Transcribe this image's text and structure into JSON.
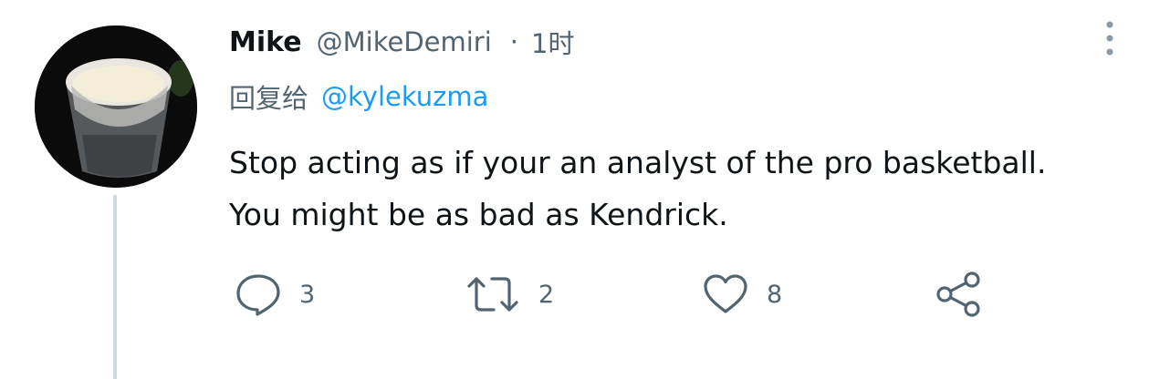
{
  "tweet": {
    "author_name": "Mike",
    "author_handle": "@MikeDemiri",
    "separator": "·",
    "timestamp": "1时",
    "reply_prefix": "回复给",
    "reply_mention": "@kylekuzma",
    "text_lines": [
      "Stop acting as if your an analyst of the pro basketball.",
      "You might be as bad as Kendrick."
    ]
  },
  "actions": {
    "reply": {
      "icon": "reply-icon",
      "count": "3"
    },
    "retweet": {
      "icon": "retweet-icon",
      "count": "2"
    },
    "like": {
      "icon": "heart-icon",
      "count": "8"
    },
    "share": {
      "icon": "share-icon"
    }
  },
  "menu": {
    "icon": "more-vertical-icon"
  },
  "colors": {
    "text": "#0f1419",
    "secondary": "#536471",
    "link": "#1d9bf0",
    "thread_line": "#cfd9de",
    "icon": "#536471"
  }
}
